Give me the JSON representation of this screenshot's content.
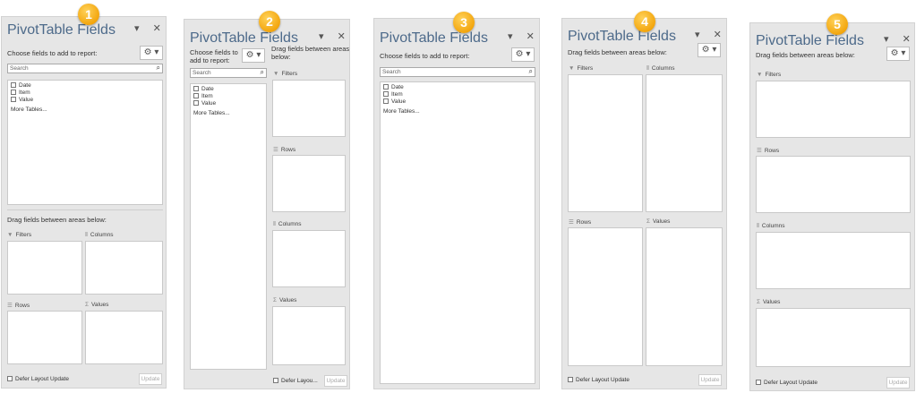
{
  "title": "PivotTable Fields",
  "choose_label": "Choose fields to add to report:",
  "choose_label_line1": "Choose fields to",
  "choose_label_line2": "add to report:",
  "drag_label": "Drag fields between areas below:",
  "drag_label_line1": "Drag fields between areas",
  "drag_label_line2": "below:",
  "search_placeholder": "Search",
  "fields": [
    "Date",
    "Item",
    "Value"
  ],
  "more_tables": "More Tables...",
  "areas": {
    "filters": "Filters",
    "columns": "Columns",
    "rows": "Rows",
    "values": "Values"
  },
  "defer_label": "Defer Layout Update",
  "defer_label_short": "Defer Layou...",
  "update_label": "Update",
  "badges": [
    "1",
    "2",
    "3",
    "4",
    "5"
  ],
  "header_buttons": {
    "dropdown": "▾",
    "close": "✕"
  },
  "icons": {
    "gear": "gear-icon",
    "filter": "filter-icon",
    "columns": "columns-icon",
    "rows": "rows-icon",
    "values": "sigma-icon",
    "search": "search-icon"
  }
}
